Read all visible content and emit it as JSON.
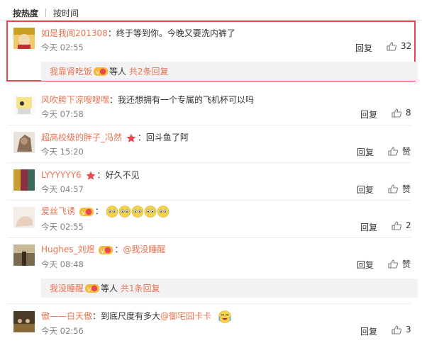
{
  "tabs": {
    "hot": "按热度",
    "time": "按时间"
  },
  "reply_label": "回复",
  "comments": [
    {
      "name": "如是我闻201308",
      "text": "终于等到你。今晚又要洗内裤了",
      "time": "今天 02:55",
      "likes": "32",
      "sub": {
        "name": "我靠肾吃饭",
        "suffix": "等人",
        "more": "共2条回复"
      }
    },
    {
      "name": "风吹胯下凉嗖嗖嘿",
      "text": "我还想拥有一个专属的飞机杯可以吗",
      "time": "今天 07:58",
      "likes": "8"
    },
    {
      "name": "超高校级的胖子_冯然",
      "text": "回斗鱼了阿",
      "time": "今天 15:20",
      "likes": "赞"
    },
    {
      "name": "LYYYYYY6",
      "text": "好久不见",
      "time": "今天 04:57",
      "likes": "赞"
    },
    {
      "name": "爱丝飞诱",
      "text": "",
      "time": "今天 02:55",
      "likes": "2"
    },
    {
      "name": "Hughes_刘煜",
      "mention": "@我没睡醒",
      "time": "今天 08:48",
      "likes": "赞",
      "sub": {
        "name": "我没睡醒",
        "suffix": "等人",
        "more": "共1条回复"
      }
    },
    {
      "name": "傲——白天傲",
      "text": "到底尺度有多大",
      "mention": "@御宅囧卡卡",
      "time": "今天 02:56",
      "likes": "3"
    }
  ],
  "colors": {
    "name": "#eb7350",
    "highlight": "#e8474c",
    "subbar": "#f2f2f5"
  }
}
